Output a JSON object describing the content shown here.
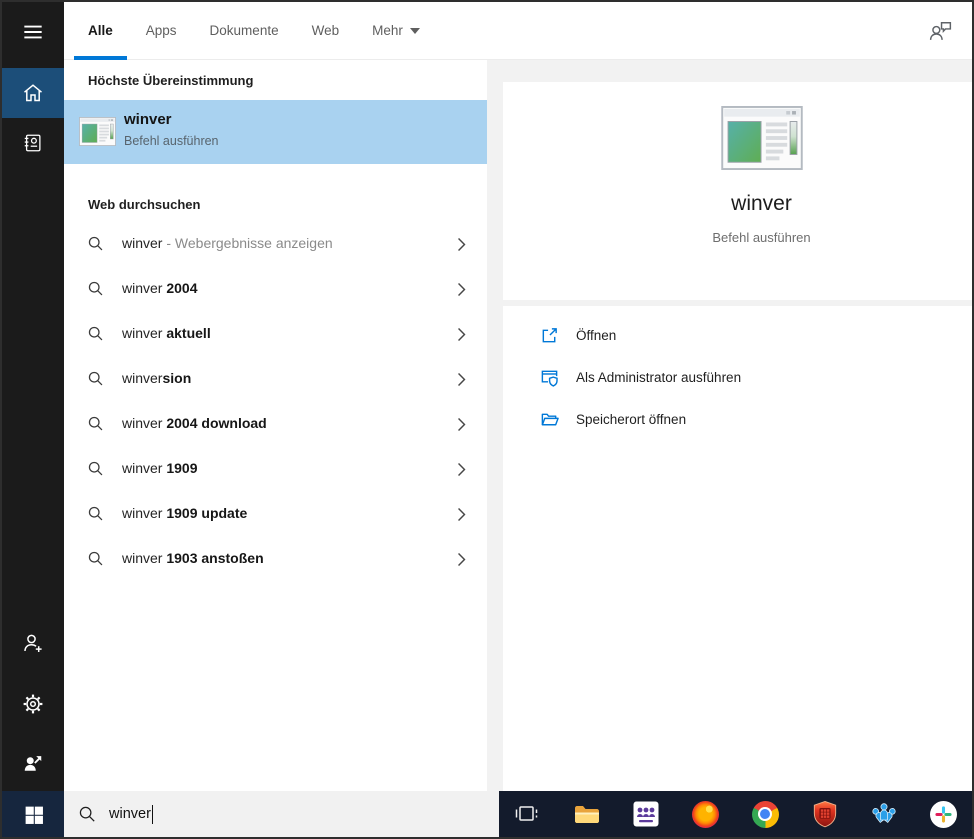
{
  "colors": {
    "accent": "#0078d7",
    "selection_blue": "#a9d2f0",
    "sidebar_bg": "#1b1b1b",
    "sidebar_active_bg": "#1c4e79",
    "taskbar_bg": "#131b2c",
    "start_button_bg": "#16263e"
  },
  "topbar": {
    "tabs": [
      {
        "label": "Alle",
        "active": true
      },
      {
        "label": "Apps",
        "active": false
      },
      {
        "label": "Dokumente",
        "active": false
      },
      {
        "label": "Web",
        "active": false
      }
    ],
    "more": {
      "label": "Mehr"
    }
  },
  "best_match": {
    "header": "Höchste Übereinstimmung",
    "item": {
      "title": "winver",
      "subtitle": "Befehl ausführen"
    }
  },
  "web_search": {
    "header": "Web durchsuchen",
    "items": [
      {
        "typed": "winver",
        "completion": " - Webergebnisse anzeigen"
      },
      {
        "typed": "winver",
        "completion": " 2004"
      },
      {
        "typed": "winver",
        "completion": " aktuell"
      },
      {
        "typed": "winver",
        "completion": "sion"
      },
      {
        "typed": "winver",
        "completion": " 2004 download"
      },
      {
        "typed": "winver",
        "completion": " 1909"
      },
      {
        "typed": "winver",
        "completion": " 1909 update"
      },
      {
        "typed": "winver",
        "completion": " 1903 anstoßen"
      }
    ]
  },
  "preview": {
    "title": "winver",
    "subtitle": "Befehl ausführen",
    "actions": [
      {
        "label": "Öffnen",
        "icon": "open-icon"
      },
      {
        "label": "Als Administrator ausführen",
        "icon": "admin-shield-icon"
      },
      {
        "label": "Speicherort öffnen",
        "icon": "file-location-icon"
      }
    ]
  },
  "search_bar": {
    "value": "winver"
  },
  "taskbar": {
    "icons": [
      "task-view",
      "file-explorer",
      "meeting-app",
      "firefox",
      "chrome",
      "security-shield-app",
      "notes-app",
      "slack"
    ]
  }
}
